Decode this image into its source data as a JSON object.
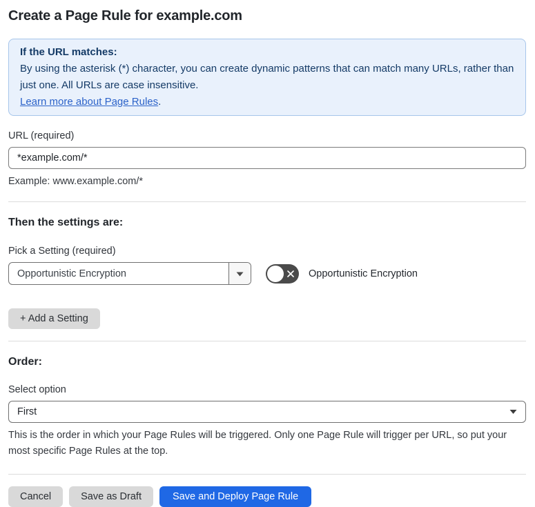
{
  "page": {
    "title": "Create a Page Rule for example.com"
  },
  "info_box": {
    "heading": "If the URL matches:",
    "body": "By using the asterisk (*) character, you can create dynamic patterns that can match many URLs, rather than just one. All URLs are case insensitive.",
    "link_label": "Learn more about Page Rules",
    "link_suffix": "."
  },
  "url_section": {
    "label": "URL (required)",
    "input_value": "*example.com/*",
    "example": "Example: www.example.com/*"
  },
  "settings_section": {
    "heading": "Then the settings are:",
    "pick_label": "Pick a Setting (required)",
    "selected_setting": "Opportunistic Encryption",
    "toggle_label": "Opportunistic Encryption",
    "toggle_state": "off",
    "add_button_label": "+ Add a Setting"
  },
  "order_section": {
    "heading": "Order:",
    "label": "Select option",
    "selected_option": "First",
    "help": "This is the order in which your Page Rules will be triggered. Only one Page Rule will trigger per URL, so put your most specific Page Rules at the top."
  },
  "footer": {
    "cancel_label": "Cancel",
    "save_draft_label": "Save as Draft",
    "save_deploy_label": "Save and Deploy Page Rule"
  },
  "colors": {
    "info_background": "#e9f1fc",
    "info_border": "#a6c5ea",
    "info_text": "#143a66",
    "link": "#2b62c9",
    "primary_button": "#1f68e5",
    "gray_button": "#d9d9d9",
    "toggle_off": "#4a4a4a",
    "divider": "#dcdcdc"
  }
}
